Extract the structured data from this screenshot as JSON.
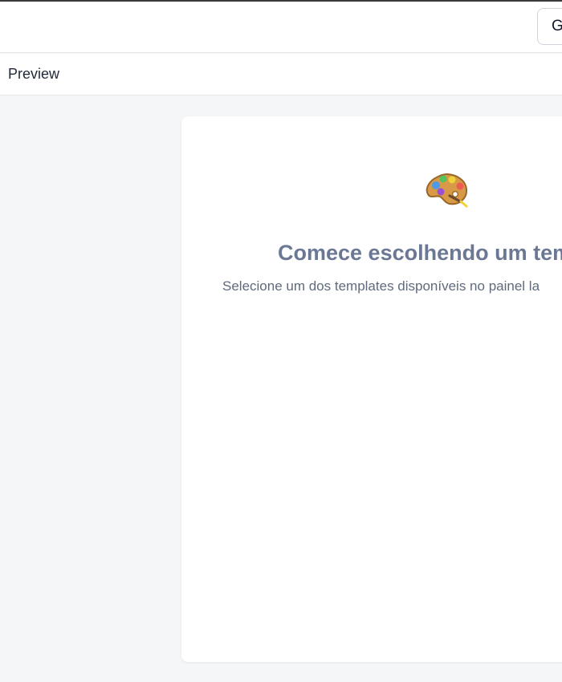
{
  "topbar": {
    "button_label": "G"
  },
  "subheader": {
    "title": "Preview"
  },
  "preview": {
    "icon": "palette-icon",
    "title": "Comece escolhendo um tem",
    "subtitle": "Selecione um dos templates disponíveis no painel la"
  },
  "colors": {
    "background": "#f5f6f8",
    "surface": "#ffffff",
    "title": "#6b7894",
    "subtitle": "#5f6b7d",
    "border": "#e5e7eb"
  }
}
